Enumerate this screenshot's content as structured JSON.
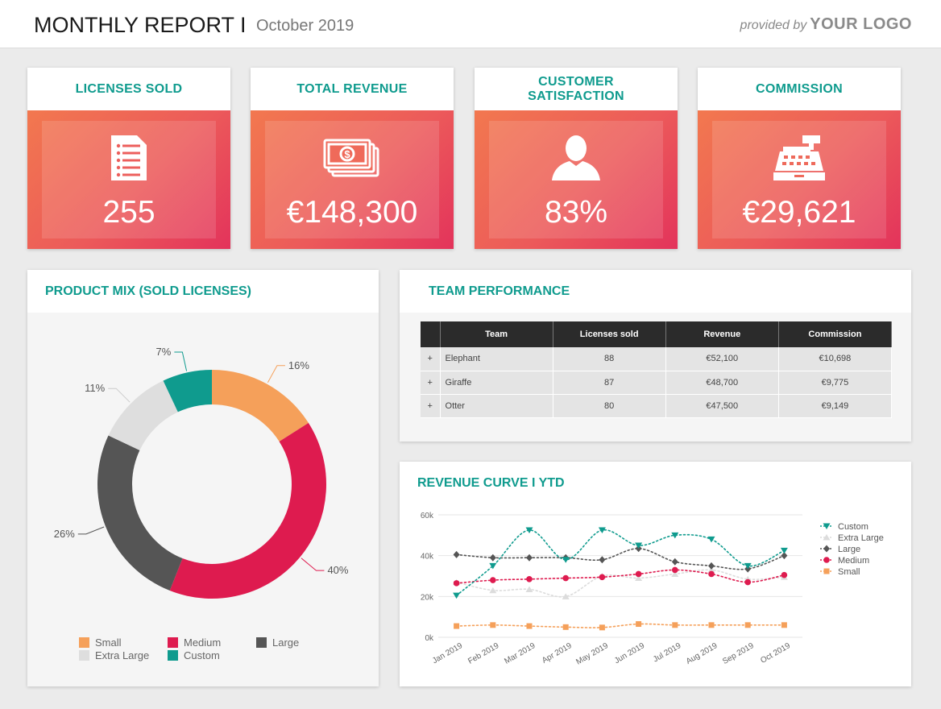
{
  "header": {
    "title": "MONTHLY REPORT I",
    "subtitle": "October 2019",
    "provided_by": "provided by",
    "logo": "YOUR LOGO"
  },
  "kpis": [
    {
      "title": "LICENSES SOLD",
      "value": "255",
      "icon": "list-document-icon"
    },
    {
      "title": "TOTAL REVENUE",
      "value": "€148,300",
      "icon": "money-bills-icon"
    },
    {
      "title": "CUSTOMER SATISFACTION",
      "value": "83%",
      "icon": "user-silhouette-icon"
    },
    {
      "title": "COMMISSION",
      "value": "€29,621",
      "icon": "cash-register-icon"
    }
  ],
  "product_mix": {
    "title": "PRODUCT MIX (SOLD LICENSES)"
  },
  "team_performance": {
    "title": "TEAM PERFORMANCE",
    "columns": [
      "Team",
      "Licenses sold",
      "Revenue",
      "Commission"
    ],
    "rows": [
      {
        "expand": "+",
        "team": "Elephant",
        "licenses": "88",
        "revenue": "€52,100",
        "commission": "€10,698"
      },
      {
        "expand": "+",
        "team": "Giraffe",
        "licenses": "87",
        "revenue": "€48,700",
        "commission": "€9,775"
      },
      {
        "expand": "+",
        "team": "Otter",
        "licenses": "80",
        "revenue": "€47,500",
        "commission": "€9,149"
      }
    ]
  },
  "revenue_curve": {
    "title": "REVENUE CURVE I YTD"
  },
  "colors": {
    "accent": "#0f9b8e",
    "small": "#f5a05a",
    "medium": "#de1b4f",
    "large": "#555555",
    "extra_large": "#dedede",
    "custom": "#0f9b8e"
  },
  "chart_data": [
    {
      "type": "pie",
      "variant": "donut",
      "title": "PRODUCT MIX (SOLD LICENSES)",
      "categories": [
        "Small",
        "Medium",
        "Large",
        "Extra Large",
        "Custom"
      ],
      "values": [
        16,
        40,
        26,
        11,
        7
      ],
      "labels": [
        "16%",
        "40%",
        "26%",
        "11%",
        "7%"
      ],
      "colors": [
        "#f5a05a",
        "#de1b4f",
        "#555555",
        "#dedede",
        "#0f9b8e"
      ],
      "legend": "bottom"
    },
    {
      "type": "line",
      "title": "REVENUE CURVE I YTD",
      "x": [
        "Jan 2019",
        "Feb 2019",
        "Mar 2019",
        "Apr 2019",
        "May 2019",
        "Jun 2019",
        "Jul 2019",
        "Aug 2019",
        "Sep 2019",
        "Oct 2019"
      ],
      "y_ticks": [
        "0k",
        "20k",
        "40k",
        "60k"
      ],
      "ylim": [
        0,
        60000
      ],
      "grid": true,
      "legend": "right",
      "series": [
        {
          "name": "Custom",
          "color": "#0f9b8e",
          "marker": "triangle-down",
          "values": [
            20500,
            35000,
            52500,
            38000,
            52500,
            45000,
            50000,
            48000,
            35000,
            42500
          ]
        },
        {
          "name": "Extra Large",
          "color": "#dcdcdc",
          "marker": "triangle-up",
          "values": [
            27000,
            23000,
            23500,
            20000,
            30000,
            29000,
            31000,
            33000,
            28500,
            29500
          ]
        },
        {
          "name": "Large",
          "color": "#555555",
          "marker": "diamond",
          "values": [
            40500,
            39000,
            39000,
            39000,
            38000,
            43500,
            37000,
            35000,
            33500,
            40000
          ]
        },
        {
          "name": "Medium",
          "color": "#de1b4f",
          "marker": "circle",
          "values": [
            26500,
            28000,
            28500,
            29000,
            29500,
            31000,
            33000,
            31000,
            27000,
            30500
          ]
        },
        {
          "name": "Small",
          "color": "#f5a05a",
          "marker": "square",
          "values": [
            5500,
            6000,
            5500,
            5000,
            4800,
            6500,
            6000,
            6000,
            6000,
            6000
          ]
        }
      ]
    }
  ]
}
